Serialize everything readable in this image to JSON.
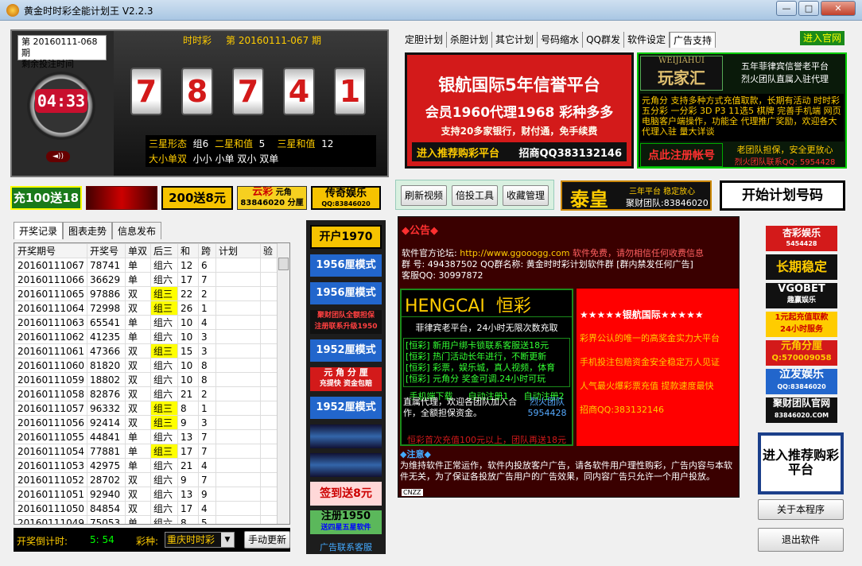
{
  "window": {
    "title": "黄金时时彩全能计划王 V2.2.3",
    "minimize": "—",
    "maximize": "□",
    "close": "✕"
  },
  "clock": {
    "period_line1": "第 20160111-068 期",
    "period_line2": "剩余投注时间",
    "countdown": "04:33",
    "speaker": "◄))",
    "header_game": "时时彩",
    "header_period": "第 20160111-067 期",
    "digits": [
      "7",
      "8",
      "7",
      "4",
      "1"
    ],
    "stats": {
      "l1": "三星形态",
      "v1": "组6",
      "l2": "二星和值",
      "v2": "5",
      "l3": "三星和值",
      "v3": "12",
      "l4": "大小单双",
      "v4": "小小",
      "v5": "小单",
      "v6": "双小",
      "v7": "双单"
    }
  },
  "banners": {
    "b1": "充100送18",
    "b3": "200送8元",
    "b4a": "云彩",
    "b4b": "元角",
    "b4c": "83846020",
    "b4d": "分厘",
    "b5": "传奇娱乐",
    "b5s": "QQ:83846020"
  },
  "tabs": [
    "开奖记录",
    "图表走势",
    "信息发布"
  ],
  "table": {
    "headers": [
      "开奖期号",
      "开奖号",
      "单双",
      "后三",
      "和",
      "跨",
      "计划",
      "验"
    ],
    "rows": [
      [
        "20160111067",
        "78741",
        "单",
        "组六",
        "12",
        "6"
      ],
      [
        "20160111066",
        "36629",
        "单",
        "组六",
        "17",
        "7"
      ],
      [
        "20160111065",
        "97886",
        "双",
        "组三",
        "22",
        "2"
      ],
      [
        "20160111064",
        "72998",
        "双",
        "组三",
        "26",
        "1"
      ],
      [
        "20160111063",
        "65541",
        "单",
        "组六",
        "10",
        "4"
      ],
      [
        "20160111062",
        "41235",
        "单",
        "组六",
        "10",
        "3"
      ],
      [
        "20160111061",
        "47366",
        "双",
        "组三",
        "15",
        "3"
      ],
      [
        "20160111060",
        "81820",
        "双",
        "组六",
        "10",
        "8"
      ],
      [
        "20160111059",
        "18802",
        "双",
        "组六",
        "10",
        "8"
      ],
      [
        "20160111058",
        "82876",
        "双",
        "组六",
        "21",
        "2"
      ],
      [
        "20160111057",
        "96332",
        "双",
        "组三",
        "8",
        "1"
      ],
      [
        "20160111056",
        "92414",
        "双",
        "组三",
        "9",
        "3"
      ],
      [
        "20160111055",
        "44841",
        "单",
        "组六",
        "13",
        "7"
      ],
      [
        "20160111054",
        "77881",
        "单",
        "组三",
        "17",
        "7"
      ],
      [
        "20160111053",
        "42975",
        "单",
        "组六",
        "21",
        "4"
      ],
      [
        "20160111052",
        "28702",
        "双",
        "组六",
        "9",
        "7"
      ],
      [
        "20160111051",
        "92940",
        "双",
        "组六",
        "13",
        "9"
      ],
      [
        "20160111050",
        "84854",
        "双",
        "组六",
        "17",
        "4"
      ],
      [
        "20160111049",
        "75053",
        "单",
        "组六",
        "8",
        "5"
      ]
    ]
  },
  "bottom": {
    "countdown_label": "开奖倒计时:",
    "countdown_value": "5: 54",
    "game_label": "彩种:",
    "game_value": "重庆时时彩",
    "manual_update": "手动更新"
  },
  "vads": [
    "开户1970",
    "1956厘模式",
    "1956厘模式",
    "聚财团队全额担保",
    "注册联系升级1950",
    "1952厘模式",
    "元 角 分 厘",
    "充提快 资金包赔",
    "1952厘模式",
    "签到送8元",
    "注册1950",
    "送四星五星软件",
    "广告联系客服"
  ],
  "rtabs": [
    "定胆计划",
    "杀胆计划",
    "其它计划",
    "号码缩水",
    "QQ群发",
    "软件设定",
    "广告支持"
  ],
  "official": "进入官网",
  "bigad": {
    "l1": "银航国际5年信誉平台",
    "l2": "会员1960代理1968 彩种多多",
    "l3": "支持20多家银行，财付通，免手续费",
    "l4": "进入推荐购彩平台",
    "l5": "招商QQ383132146"
  },
  "wj": {
    "en": "WEIJIAHUI",
    "cn": "玩家汇",
    "t1": "五年菲律宾信誉老平台",
    "t2": "烈火团队直属入驻代理",
    "body": "元角分 支持多种方式充值取款，长期有活动 时时彩 五分彩 一分彩 3D P3 11选5 棋牌 完善手机端 网页 电脑客户端操作，功能全 代理推广奖励，欢迎各大代理入驻 量大详谈",
    "reg": "点此注册帐号",
    "g1": "老团队担保，安全更放心",
    "g2": "烈火团队联系QQ: 5954428"
  },
  "midbtns": [
    "刷新视频",
    "倍投工具",
    "收藏管理"
  ],
  "taihuang": {
    "t": "泰皇",
    "s1": "三年平台 稳定放心",
    "s2": "聚财团队:83846020"
  },
  "start": "开始计划号码",
  "notice": {
    "title": "◆公告◆",
    "l1a": "软件官方论坛:",
    "l1b": "http://www.ggooogg.com",
    "l1c": "软件免费，请勿相信任何收费信息",
    "l2": "群 号: 494387502 QQ群名称: 黄金时时彩计划软件群 [群内禁发任何广告]",
    "l3": "客服QQ: 30997872",
    "hc_en": "HENGCAI",
    "hc_cn": "恒彩",
    "hc_sub": "菲律宾老平台，24小时无限次数充取",
    "hc_lines": [
      "[恒彩] 新用户绑卡锁联系客服送18元",
      "[恒彩] 热门活动长年进行，不断更新",
      "[恒彩] 彩票，娱乐城，真人视频，体育",
      "[恒彩] 元角分 奖金可调.24小时可玩"
    ],
    "hc_b1": "手机端下载",
    "hc_b2": "自动注册1",
    "hc_b3": "自动注册2",
    "hc_agent": "直属代理，欢迎各团队加入合作，全额担保资金。",
    "hc_lh1": "烈火团队",
    "hc_lh2": "5954428",
    "hc_bottom": "恒彩首次充值100元以上，团队再送18元",
    "yh_title": "★★★★★银航国际★★★★★",
    "yh1": "彩界公认的唯一的高奖金实力大平台",
    "yh2": "手机投注包赔资金安全稳定万人见证",
    "yh3": "人气最火爆彩票充值 提款速度最快",
    "yh4": "招商QQ:383132146",
    "att_title": "◆注意◆",
    "att": "为维持软件正常运作，软件内投放客户广告，请各软件用户理性购彩，广告内容与本软件无关，为了保证各投放广告用户的广告效果，同内容广告只允许一个用户投放。",
    "cnzz": "CNZZ"
  },
  "sideads": [
    "杏彩娱乐",
    "5454428",
    "长期稳定",
    "VGOBET",
    "趣赢娱乐",
    "1元起充值取款",
    "24小时服务",
    "元角分厘",
    "Q:570009058",
    "泣发娱乐",
    "QQ:83846020",
    "聚财团队官网",
    "83846020.COM"
  ],
  "recommend": "进入推荐购彩平台",
  "about": "关于本程序",
  "exit": "退出软件"
}
